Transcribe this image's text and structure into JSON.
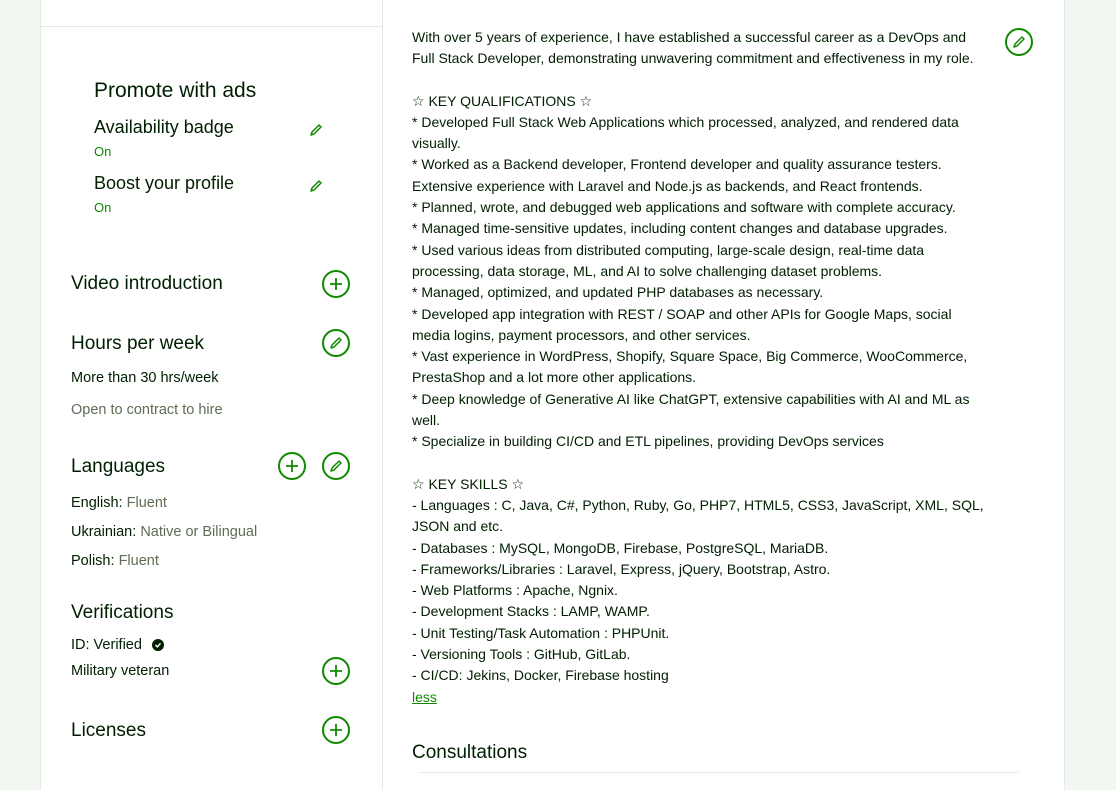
{
  "sidebar": {
    "promote": {
      "title": "Promote with ads",
      "availability": {
        "label": "Availability badge",
        "status": "On"
      },
      "boost": {
        "label": "Boost your profile",
        "status": "On"
      }
    },
    "video": {
      "title": "Video introduction"
    },
    "hours": {
      "title": "Hours per week",
      "value": "More than 30 hrs/week",
      "contract": "Open to contract to hire"
    },
    "languages": {
      "title": "Languages",
      "items": [
        {
          "name": "English:",
          "level": "Fluent"
        },
        {
          "name": "Ukrainian:",
          "level": "Native or Bilingual"
        },
        {
          "name": "Polish:",
          "level": "Fluent"
        }
      ]
    },
    "verifications": {
      "title": "Verifications",
      "id_label": "ID: Verified",
      "military": "Military veteran"
    },
    "licenses": {
      "title": "Licenses"
    }
  },
  "main": {
    "lines": [
      "With over 5 years of experience, I have established a successful career as a DevOps and",
      "Full Stack Developer, demonstrating unwavering commitment and effectiveness in my role.",
      "",
      "☆ KEY QUALIFICATIONS ☆",
      "* Developed Full Stack Web Applications which processed, analyzed, and rendered data",
      "visually.",
      "* Worked as a Backend developer, Frontend developer and quality assurance testers.",
      "Extensive experience with Laravel and Node.js as backends, and React frontends.",
      "* Planned, wrote, and debugged web applications and software with complete accuracy.",
      "* Managed time-sensitive updates, including content changes and database upgrades.",
      "* Used various ideas from distributed computing, large-scale design, real-time data",
      "processing, data storage, ML, and AI to solve challenging dataset problems.",
      "* Managed, optimized, and updated PHP databases as necessary.",
      "* Developed app integration with REST / SOAP and other APIs for Google Maps, social",
      "media logins, payment processors, and other services.",
      "* Vast experience in WordPress, Shopify, Square Space, Big Commerce, WooCommerce,",
      "PrestaShop and a lot more other applications.",
      "* Deep knowledge of Generative AI like ChatGPT, extensive capabilities with AI and ML as",
      "well.",
      "* Specialize in building CI/CD and ETL pipelines, providing DevOps services",
      "",
      "☆ KEY SKILLS ☆",
      "- Languages : C, Java, C#, Python, Ruby, Go, PHP7, HTML5, CSS3, JavaScript, XML, SQL,",
      "JSON and etc.",
      "- Databases : MySQL, MongoDB, Firebase, PostgreSQL, MariaDB.",
      "- Frameworks/Libraries : Laravel, Express, jQuery, Bootstrap, Astro.",
      "- Web Platforms : Apache, Ngnix.",
      "- Development Stacks : LAMP, WAMP.",
      "- Unit Testing/Task Automation : PHPUnit.",
      "- Versioning Tools : GitHub, GitLab.",
      "- CI/CD: Jekins, Docker, Firebase hosting"
    ],
    "less_label": "less",
    "consultations_title": "Consultations"
  },
  "icons": {
    "pencil": "pencil-icon",
    "plus": "plus-icon",
    "verified": "check-badge-icon"
  },
  "colors": {
    "accent": "#108a00",
    "text": "#001e00",
    "muted": "#5e6d55",
    "background": "#f2f7f2"
  }
}
